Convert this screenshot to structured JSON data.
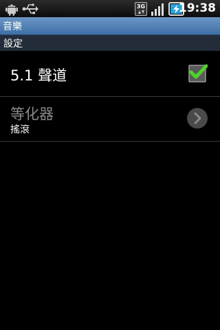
{
  "status_bar": {
    "time": "19:38",
    "network_badge": "3G",
    "icons": [
      "android-icon",
      "usb-icon",
      "3g-icon",
      "signal-icon",
      "battery-charging-icon"
    ]
  },
  "app": {
    "title": "音樂"
  },
  "section": {
    "title": "設定"
  },
  "preferences": [
    {
      "title": "5.1 聲道",
      "checked": true,
      "enabled": true
    },
    {
      "title": "等化器",
      "summary": "搖滾",
      "enabled": false
    }
  ],
  "colors": {
    "title_bar": "#4f80b6",
    "section_header": "#232d39",
    "check_green": "#4cd42a",
    "disabled_text": "#8a8a8a"
  }
}
